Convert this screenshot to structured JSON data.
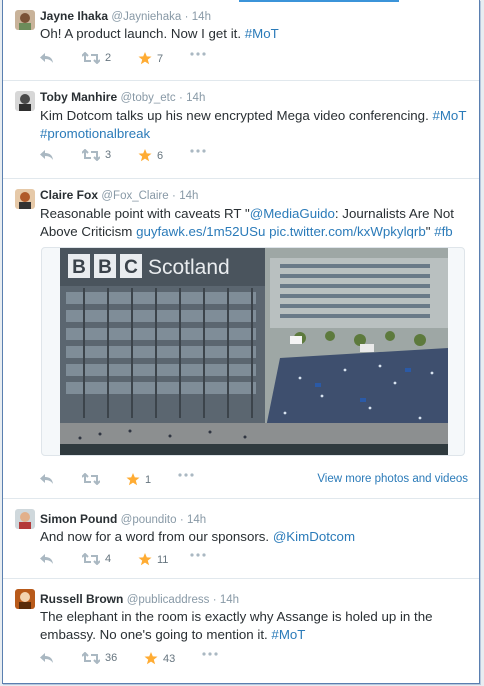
{
  "tweets": [
    {
      "name": "Jayne Ihaka",
      "handle": "@Jayniehaka",
      "time": "14h",
      "text_plain": "Oh! A product launch. Now I get it. ",
      "text_link": "#MoT",
      "retweets": "2",
      "favorites": "7"
    },
    {
      "name": "Toby Manhire",
      "handle": "@toby_etc",
      "time": "14h",
      "text_plain": "Kim Dotcom talks up his new encrypted Mega video conferencing. ",
      "text_link": "#MoT",
      "text_link2": "#promotionalbreak",
      "retweets": "3",
      "favorites": "6"
    },
    {
      "name": "Claire Fox",
      "handle": "@Fox_Claire",
      "time": "14h",
      "text_plain": "Reasonable point with caveats RT \"",
      "text_link": "@MediaGuido",
      "text_plain2": ": Journalists Are Not Above Criticism ",
      "text_link2": "guyfawk.es/1m52USu",
      "text_link3": "pic.twitter.com/kxWpkylqrb",
      "text_plain3": "\" ",
      "text_link4": "#fb",
      "image_sign": "BBC Scotland",
      "retweets": "",
      "favorites": "1",
      "view_more": "View more photos and videos"
    },
    {
      "name": "Simon Pound",
      "handle": "@poundito",
      "time": "14h",
      "text_plain": "And now for a word from our sponsors. ",
      "text_link": "@KimDotcom",
      "retweets": "4",
      "favorites": "11"
    },
    {
      "name": "Russell Brown",
      "handle": "@publicaddress",
      "time": "14h",
      "text_plain": "The elephant in the room is exactly why Assange is holed up in the embassy. No one's going to mention it. ",
      "text_link": "#MoT",
      "retweets": "36",
      "favorites": "43"
    }
  ],
  "colors": {
    "link": "#2b7bb9",
    "favorite_star": "#ffac33",
    "muted": "#8899a6"
  },
  "icons": [
    "reply-icon",
    "retweet-icon",
    "favorite-star-icon",
    "more-dots-icon"
  ]
}
